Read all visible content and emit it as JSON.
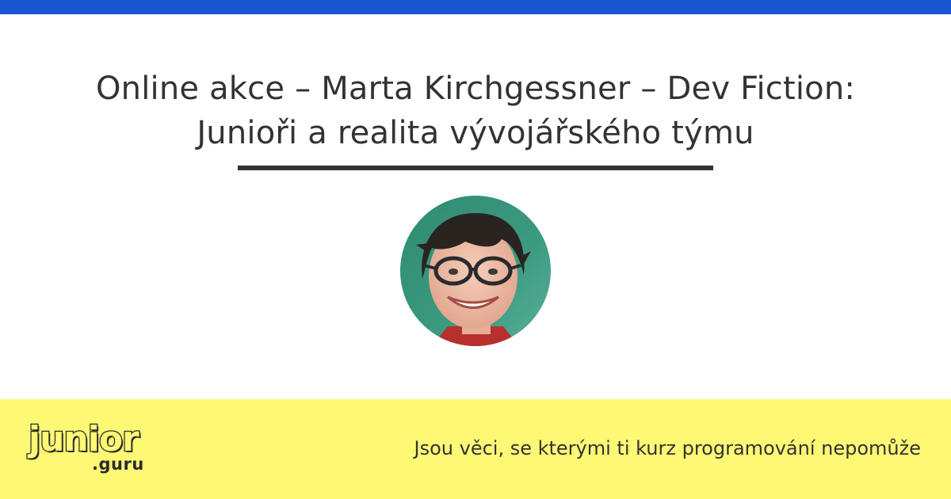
{
  "title": {
    "line1": "Online akce – Marta Kirchgessner – Dev Fiction:",
    "line2": "Junioři a realita vývojářského týmu"
  },
  "avatar": {
    "description_icon": "speaker-photo"
  },
  "footer": {
    "logo_main": "junior",
    "logo_sub": ".guru",
    "tagline": "Jsou věci, se kterými ti kurz programování nepomůže"
  },
  "colors": {
    "top_bar": "#1755d1",
    "footer_bg": "#fef974",
    "text": "#333333"
  }
}
